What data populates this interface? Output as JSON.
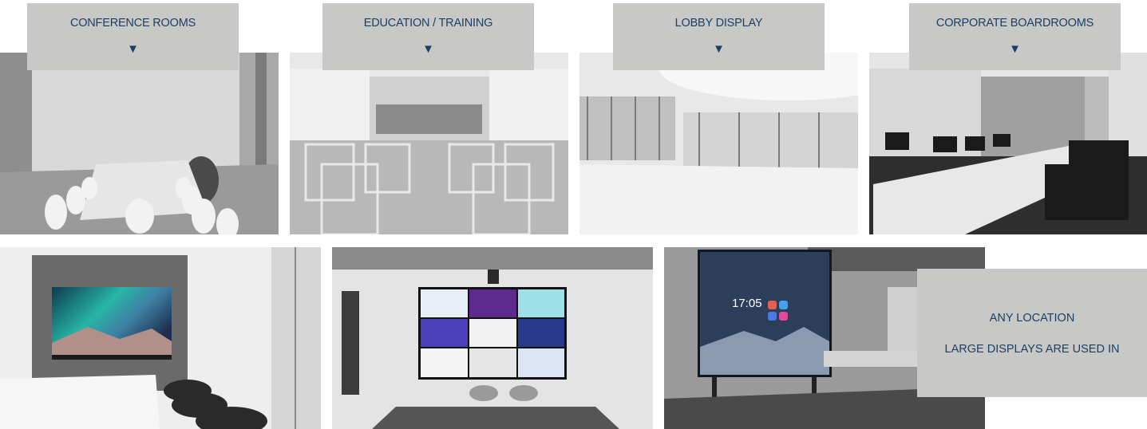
{
  "top_row": [
    {
      "label": "CONFERENCE ROOMS",
      "arrow": "▼"
    },
    {
      "label": "EDUCATION / TRAINING",
      "arrow": "▼"
    },
    {
      "label": "LOBBY DISPLAY",
      "arrow": "▼"
    },
    {
      "label": "CORPORATE BOARDROOMS",
      "arrow": "▼"
    }
  ],
  "any_location": {
    "line1": "ANY LOCATION",
    "line2": "LARGE DISPLAYS ARE USED IN"
  },
  "display_screen": {
    "time": "17:05"
  },
  "colors": {
    "label_bg": "#c8c8c6",
    "label_text": "#1c3f66"
  }
}
